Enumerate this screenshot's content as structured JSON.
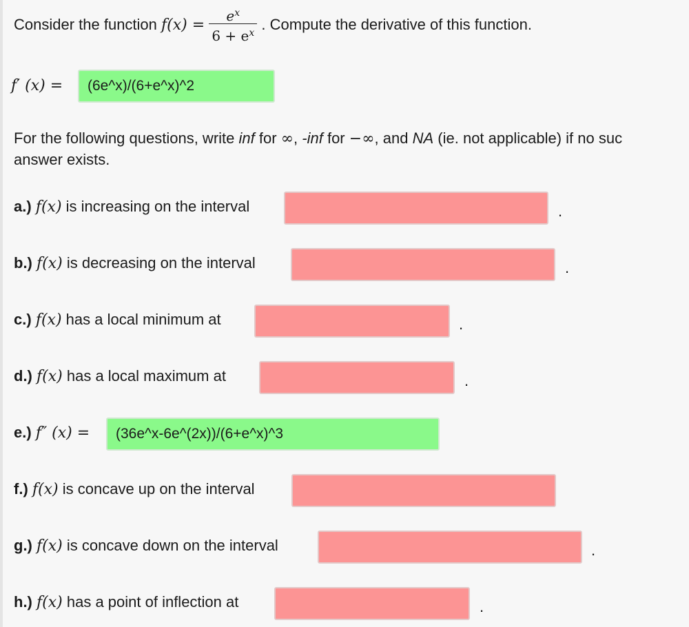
{
  "problem": {
    "prefix": "Consider the function",
    "func": "f(x) =",
    "numerator": "e",
    "num_exp": "x",
    "denominator": "6 + e",
    "den_exp": "x",
    "suffix": ". Compute the derivative of this function."
  },
  "derivative": {
    "label": "f′ (x) =",
    "value": "(6e^x)/(6+e^x)^2",
    "status": "correct"
  },
  "instructions": {
    "line1_a": "For the following questions, write",
    "inf": "inf",
    "for1": "for",
    "infinity": "∞",
    "neg_inf": "-inf",
    "for2": "for",
    "neg_infinity": "−∞",
    "and": ", and",
    "na": "NA",
    "line1_b": "(ie. not applicable) if no suc",
    "line2": "answer exists."
  },
  "questions": [
    {
      "letter": "a.)",
      "func": "f(x)",
      "text": "is increasing on the interval",
      "value": "",
      "status": "incorrect",
      "trailing": "."
    },
    {
      "letter": "b.)",
      "func": "f(x)",
      "text": "is decreasing on the interval",
      "value": "",
      "status": "incorrect",
      "trailing": "."
    },
    {
      "letter": "c.)",
      "func": "f(x)",
      "text": "has a local minimum at",
      "value": "",
      "status": "incorrect",
      "trailing": "."
    },
    {
      "letter": "d.)",
      "func": "f(x)",
      "text": "has a local maximum at",
      "value": "",
      "status": "incorrect",
      "trailing": "."
    },
    {
      "letter": "e.)",
      "func": "f″ (x) =",
      "text": "",
      "value": "(36e^x-6e^(2x))/(6+e^x)^3",
      "status": "correct",
      "trailing": ""
    },
    {
      "letter": "f.)",
      "func": "f(x)",
      "text": "is concave up on the interval",
      "value": "",
      "status": "incorrect",
      "trailing": ""
    },
    {
      "letter": "g.)",
      "func": "f(x)",
      "text": "is concave down on the interval",
      "value": "",
      "status": "incorrect",
      "trailing": "."
    },
    {
      "letter": "h.)",
      "func": "f(x)",
      "text": "has a point of inflection at",
      "value": "",
      "status": "incorrect",
      "trailing": "."
    }
  ],
  "colors": {
    "correct": "#8af98a",
    "incorrect": "#fc9494"
  }
}
